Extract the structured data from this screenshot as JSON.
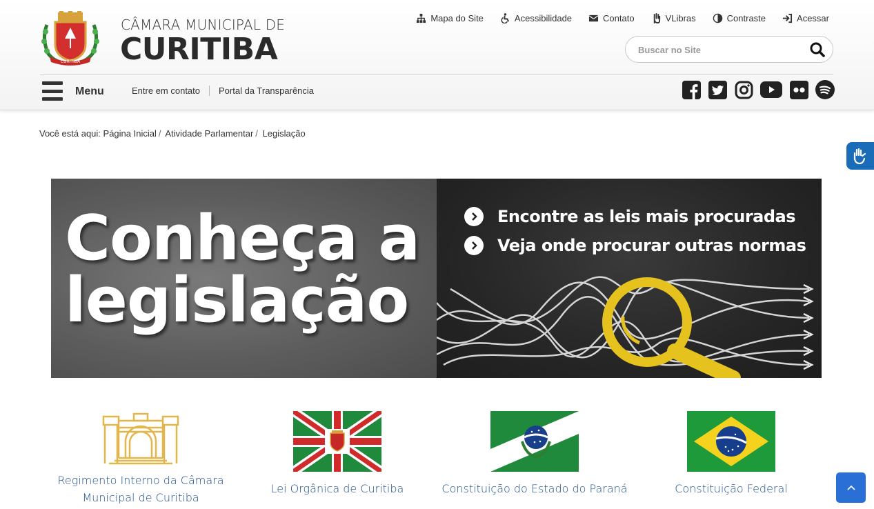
{
  "header": {
    "title_small": "CÂMARA MUNICIPAL DE",
    "title_big": "CURITIBA",
    "crest_ribbon_text": "CURITIBA",
    "toplinks": [
      {
        "label": "Mapa do Site",
        "icon": "sitemap-icon"
      },
      {
        "label": "Acessibilidade",
        "icon": "wheelchair-icon"
      },
      {
        "label": "Contato",
        "icon": "envelope-icon"
      },
      {
        "label": "VLibras",
        "icon": "hand-icon"
      },
      {
        "label": "Contraste",
        "icon": "contrast-icon"
      },
      {
        "label": "Acessar",
        "icon": "sign-in-icon"
      }
    ],
    "search_placeholder": "Buscar no Site",
    "menu_label": "Menu",
    "sublinks": [
      "Entre em contato",
      "Portal da Transparência"
    ],
    "social": [
      "facebook-icon",
      "twitter-icon",
      "instagram-icon",
      "youtube-icon",
      "flickr-icon",
      "spotify-icon"
    ]
  },
  "breadcrumb": {
    "prefix": "Você está aqui:",
    "items": [
      "Página Inicial",
      "Atividade Parlamentar",
      "Legislação"
    ]
  },
  "banner": {
    "title_line1": "Conheça a",
    "title_line2": "legislação",
    "bullets": [
      "Encontre as leis mais procuradas",
      "Veja onde procurar outras normas"
    ]
  },
  "cards": [
    {
      "label_line1": "Regimento Interno da Câmara",
      "label_line2": "Municipal de Curitiba",
      "icon": "building-icon"
    },
    {
      "label_line1": "Lei Orgânica de Curitiba",
      "label_line2": "",
      "icon": "curitiba-flag-icon"
    },
    {
      "label_line1": "Constituição do Estado do Paraná",
      "label_line2": "",
      "icon": "parana-flag-icon"
    },
    {
      "label_line1": "Constituição Federal",
      "label_line2": "",
      "icon": "brazil-flag-icon"
    }
  ],
  "colors": {
    "link_blue": "#1b4f8a",
    "accent_blue": "#2a6fd6",
    "curitiba_green": "#1f8a3b",
    "curitiba_red": "#d12a2a",
    "gold": "#e2b64a"
  }
}
